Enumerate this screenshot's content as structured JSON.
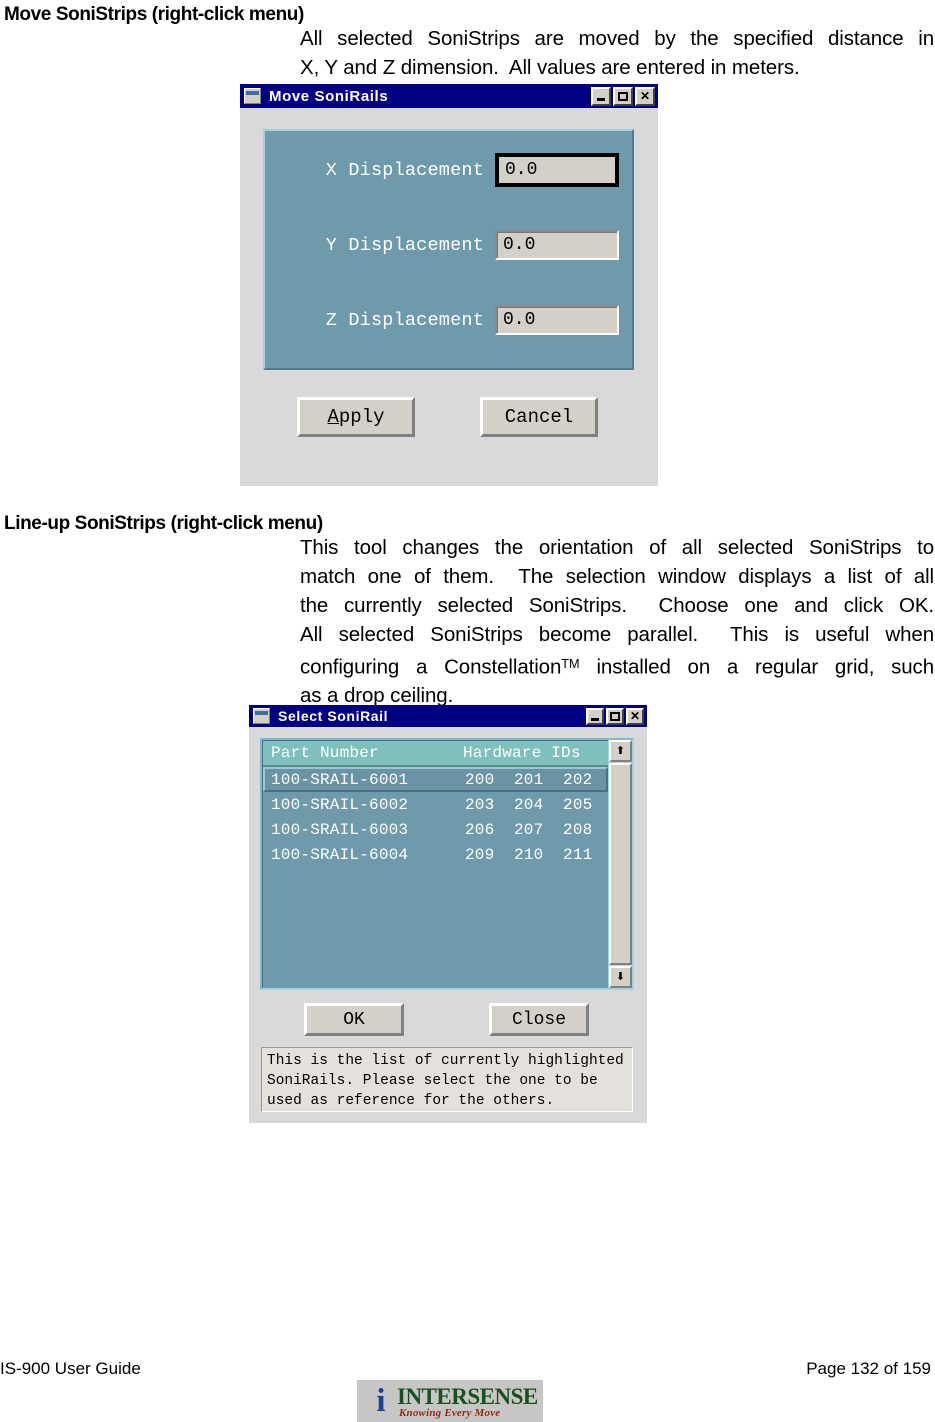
{
  "sections": [
    {
      "heading": "Move SoniStrips (right-click menu)",
      "paragraph_lines": [
        "All selected SoniStrips are moved by the specified distance in",
        "X, Y and Z dimension.  All values are entered in meters."
      ]
    },
    {
      "heading": "Line-up SoniStrips (right-click menu)",
      "paragraph_lines": [
        "This tool changes the orientation of all selected SoniStrips to",
        "match one of them.  The selection window displays a list of all",
        "the currently selected SoniStrips.  Choose one and click OK.",
        "All selected SoniStrips become parallel.  This is useful when",
        "configuring a Constellation",
        "installed on a regular grid, such",
        "as a drop ceiling."
      ],
      "trademark_symbol": "TM"
    }
  ],
  "dialog_move": {
    "title": "Move SoniRails",
    "title_buttons": {
      "minimize": "_",
      "maximize": "□",
      "close": "✕"
    },
    "fields": [
      {
        "label": "X Displacement",
        "value": "0.0",
        "focused": true
      },
      {
        "label": "Y Displacement",
        "value": "0.0",
        "focused": false
      },
      {
        "label": "Z Displacement",
        "value": "0.0",
        "focused": false
      }
    ],
    "buttons": {
      "apply_mnemonic": "A",
      "apply_rest": "pply",
      "cancel": "Cancel"
    },
    "panel_color": "#6f9aac"
  },
  "dialog_select": {
    "title": "Select SoniRail",
    "title_buttons": {
      "minimize": "_",
      "maximize": "□",
      "close": "✕"
    },
    "list": {
      "headers": {
        "part_number": "Part Number",
        "hardware_ids": "Hardware IDs"
      },
      "rows": [
        {
          "part_number": "100-SRAIL-6001",
          "hardware_ids": "200  201  202",
          "selected": true
        },
        {
          "part_number": "100-SRAIL-6002",
          "hardware_ids": "203  204  205",
          "selected": false
        },
        {
          "part_number": "100-SRAIL-6003",
          "hardware_ids": "206  207  208",
          "selected": false
        },
        {
          "part_number": "100-SRAIL-6004",
          "hardware_ids": "209  210  211",
          "selected": false
        }
      ],
      "header_color": "#7fc0bc",
      "body_color": "#6f9aac"
    },
    "scrollbar": {
      "up_arrow": "⬆",
      "down_arrow": "⬇"
    },
    "buttons": {
      "ok": "OK",
      "close": "Close"
    },
    "help_lines": [
      "This is the list of currently highlighted",
      "SoniRails. Please select the one to be",
      "used as reference for the others."
    ]
  },
  "footer": {
    "document_title": "IS-900 User Guide",
    "page_label": "Page 132 of 159",
    "logo": {
      "mark": "i",
      "wordmark": "INTERSENSE",
      "tagline": "Knowing Every Move"
    }
  }
}
